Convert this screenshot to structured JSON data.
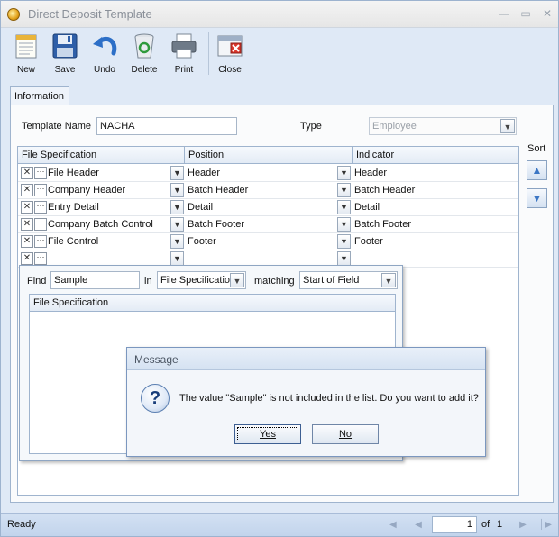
{
  "window": {
    "title": "Direct Deposit Template"
  },
  "toolbar": {
    "new": "New",
    "save": "Save",
    "undo": "Undo",
    "delete": "Delete",
    "print": "Print",
    "close": "Close"
  },
  "tabs": {
    "information": "Information"
  },
  "form": {
    "template_name_label": "Template Name",
    "template_name_value": "NACHA",
    "type_label": "Type",
    "type_value": "Employee"
  },
  "grid": {
    "headers": [
      "File Specification",
      "Position",
      "Indicator"
    ],
    "rows": [
      {
        "spec": "File Header",
        "position": "Header",
        "indicator": "Header"
      },
      {
        "spec": "Company Header",
        "position": "Batch Header",
        "indicator": "Batch Header"
      },
      {
        "spec": "Entry Detail",
        "position": "Detail",
        "indicator": "Detail"
      },
      {
        "spec": "Company Batch Control",
        "position": "Batch Footer",
        "indicator": "Batch Footer"
      },
      {
        "spec": "File Control",
        "position": "Footer",
        "indicator": "Footer"
      },
      {
        "spec": "",
        "position": "",
        "indicator": ""
      }
    ]
  },
  "sort": {
    "label": "Sort"
  },
  "find": {
    "find_label": "Find",
    "find_value": "Sample",
    "in_label": "in",
    "in_value": "File Specification",
    "matching_label": "matching",
    "matching_value": "Start of Field",
    "list_header": "File Specification"
  },
  "dialog": {
    "title": "Message",
    "message": "The value \"Sample\" is not included in the list. Do you want to add it?",
    "yes": "Yes",
    "no": "No"
  },
  "status": {
    "text": "Ready",
    "page": "1",
    "of": "of",
    "total": "1"
  }
}
